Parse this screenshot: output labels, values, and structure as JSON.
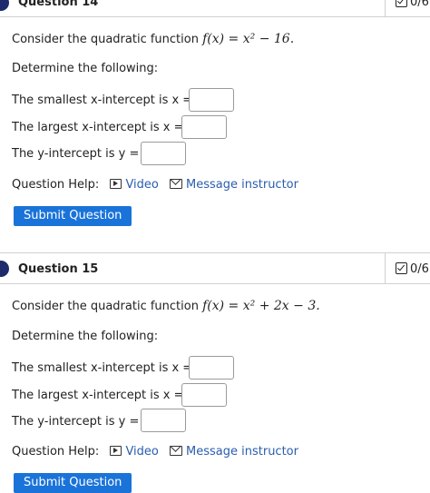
{
  "questions": [
    {
      "title": "Question 14",
      "score": "0/6",
      "intro": "Consider the quadratic function",
      "function": "f(x) = x² − 16.",
      "determine": "Determine the following:",
      "smallest_label": "The smallest x-intercept is x =",
      "largest_label": "The largest x-intercept is x =",
      "yint_label": "The y-intercept is y =",
      "help_label": "Question Help:",
      "video_label": "Video",
      "message_label": "Message instructor",
      "submit_label": "Submit Question"
    },
    {
      "title": "Question 15",
      "score": "0/6",
      "intro": "Consider the quadratic function",
      "function": "f(x) = x² + 2x − 3.",
      "determine": "Determine the following:",
      "smallest_label": "The smallest x-intercept is x =",
      "largest_label": "The largest x-intercept is x =",
      "yint_label": "The y-intercept is y =",
      "help_label": "Question Help:",
      "video_label": "Video",
      "message_label": "Message instructor",
      "submit_label": "Submit Question"
    }
  ],
  "colors": {
    "link": "#2a5db0",
    "button": "#1a73d9",
    "dot": "#1d2a6b"
  },
  "icons": [
    "checkbox-icon",
    "video-icon",
    "mail-icon"
  ]
}
